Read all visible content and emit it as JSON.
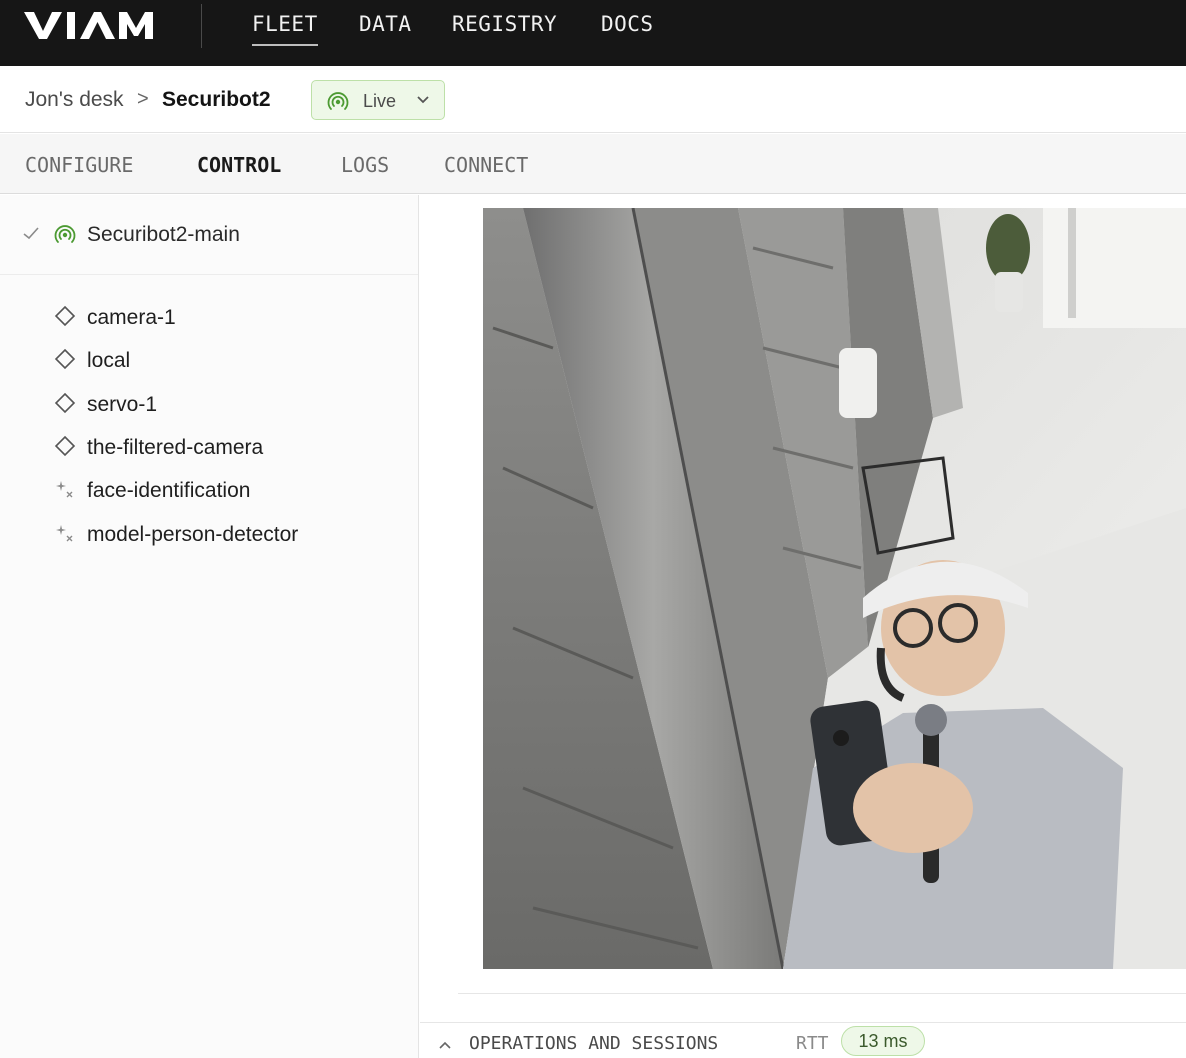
{
  "app": {
    "logo_text": "VIAM"
  },
  "topnav": {
    "items": [
      {
        "label": "FLEET",
        "active": true
      },
      {
        "label": "DATA"
      },
      {
        "label": "REGISTRY"
      },
      {
        "label": "DOCS"
      }
    ]
  },
  "breadcrumb": {
    "parent": "Jon's desk",
    "separator": ">",
    "current": "Securibot2",
    "status": {
      "label": "Live",
      "icon": "signal-icon",
      "color": "#4c9a32"
    }
  },
  "tabs": [
    {
      "label": "CONFIGURE"
    },
    {
      "label": "CONTROL",
      "active": true
    },
    {
      "label": "LOGS"
    },
    {
      "label": "CONNECT"
    }
  ],
  "sidebar": {
    "machine": {
      "name": "Securibot2-main",
      "icon": "signal-icon",
      "status": "check-icon"
    },
    "resources": [
      {
        "name": "camera-1",
        "icon": "component-diamond-icon"
      },
      {
        "name": "local",
        "icon": "component-diamond-icon"
      },
      {
        "name": "servo-1",
        "icon": "component-diamond-icon"
      },
      {
        "name": "the-filtered-camera",
        "icon": "component-diamond-icon"
      },
      {
        "name": "face-identification",
        "icon": "service-sparkle-icon"
      },
      {
        "name": "model-person-detector",
        "icon": "service-sparkle-icon"
      }
    ]
  },
  "main": {
    "feed": {
      "description": "camera-feed"
    },
    "operations": {
      "label": "OPERATIONS AND SESSIONS",
      "rtt_label": "RTT",
      "rtt_value": "13 ms"
    }
  },
  "colors": {
    "nav_bg": "#161616",
    "live_green": "#4c9a32",
    "live_bg": "#eef8e8"
  }
}
